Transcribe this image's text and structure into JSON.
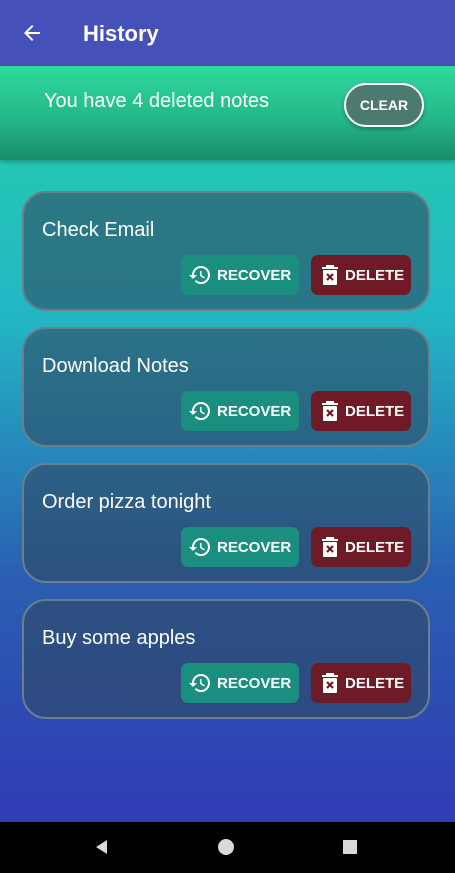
{
  "app_bar": {
    "title": "History",
    "back_icon": "arrow-back-icon",
    "background": "#4550b8"
  },
  "banner": {
    "message": "You have 4 deleted notes",
    "clear_label": "CLEAR",
    "background": "#24b889"
  },
  "notes": [
    {
      "title": "Check Email",
      "recover_label": "RECOVER",
      "delete_label": "DELETE"
    },
    {
      "title": "Download Notes",
      "recover_label": "RECOVER",
      "delete_label": "DELETE"
    },
    {
      "title": "Order pizza tonight",
      "recover_label": "RECOVER",
      "delete_label": "DELETE"
    },
    {
      "title": "Buy some apples",
      "recover_label": "RECOVER",
      "delete_label": "DELETE"
    }
  ],
  "colors": {
    "recover_button": "#1b8f7f",
    "delete_button": "#6f1b27",
    "gradient_top": "#28d4a4",
    "gradient_bottom": "#3039b4"
  },
  "icons": {
    "recover": "history-restore-icon",
    "delete": "delete-box-icon"
  },
  "nav_bar": {
    "back_icon": "nav-back-triangle-icon",
    "home_icon": "nav-home-circle-icon",
    "recents_icon": "nav-recents-square-icon"
  }
}
